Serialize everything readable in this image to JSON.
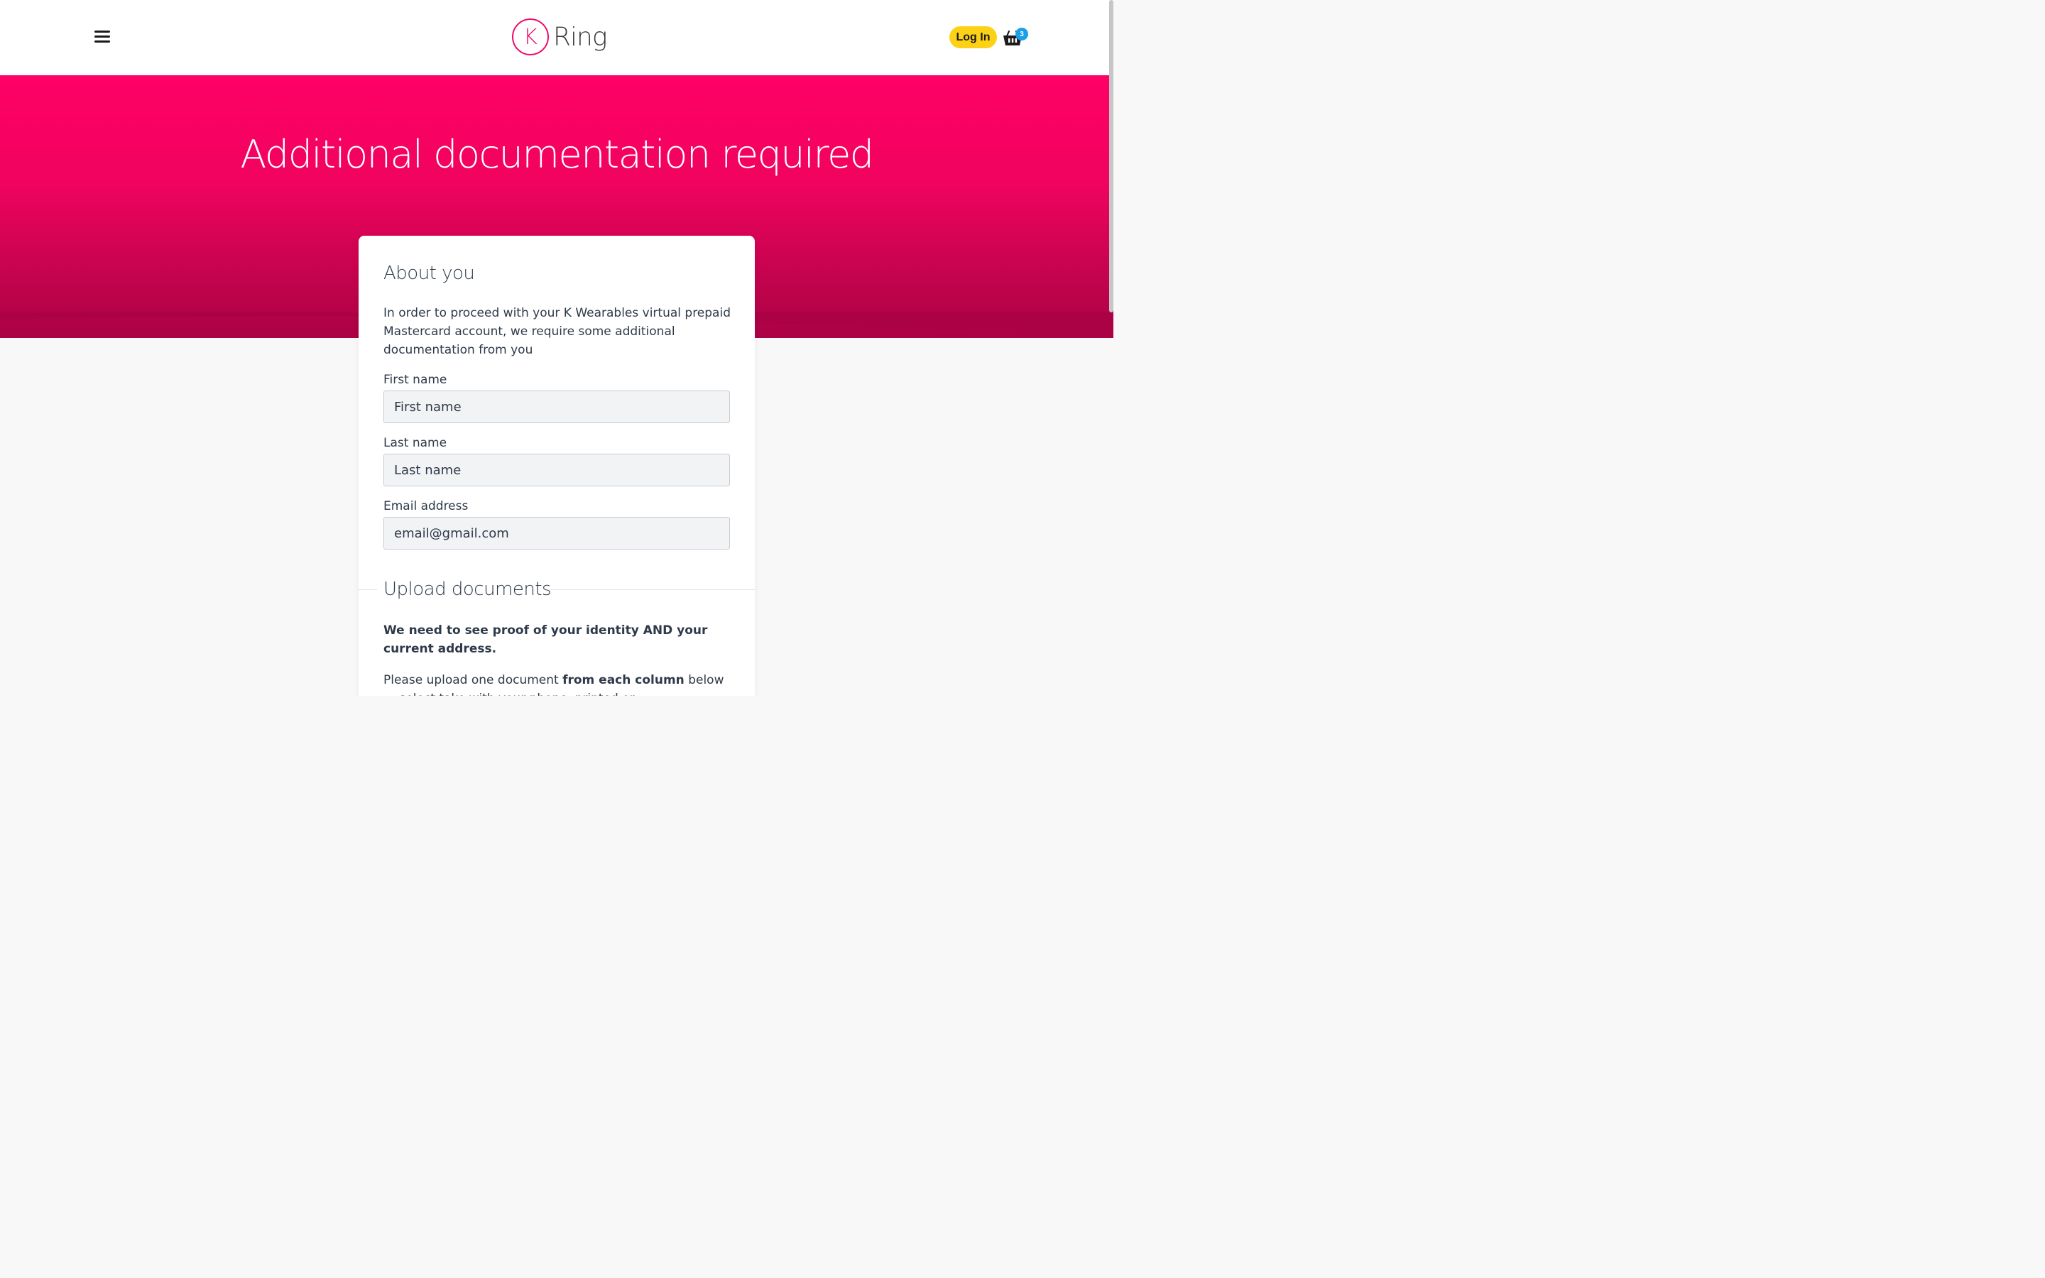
{
  "header": {
    "brand_mark": "K",
    "brand_name": "Ring",
    "login_label": "Log In",
    "basket_count": "3"
  },
  "hero": {
    "title": "Additional documentation required"
  },
  "about": {
    "title": "About you",
    "intro": "In order to proceed with your K Wearables virtual prepaid Mastercard account, we require some additional documentation from you",
    "first_name_label": "First name",
    "first_name_placeholder": "First name",
    "last_name_label": "Last name",
    "last_name_placeholder": "Last name",
    "email_label": "Email address",
    "email_value": "email@gmail.com"
  },
  "upload": {
    "title": "Upload documents",
    "proof_text": "We need to see proof of your identity AND your current address.",
    "instruction_prefix": "Please upload one document ",
    "instruction_bold": "from each column",
    "instruction_suffix": " below — select take with your phone, printed or"
  },
  "colors": {
    "brand_pink": "#ff0066",
    "login_yellow": "#fcd116",
    "badge_blue": "#1aa0e6"
  }
}
